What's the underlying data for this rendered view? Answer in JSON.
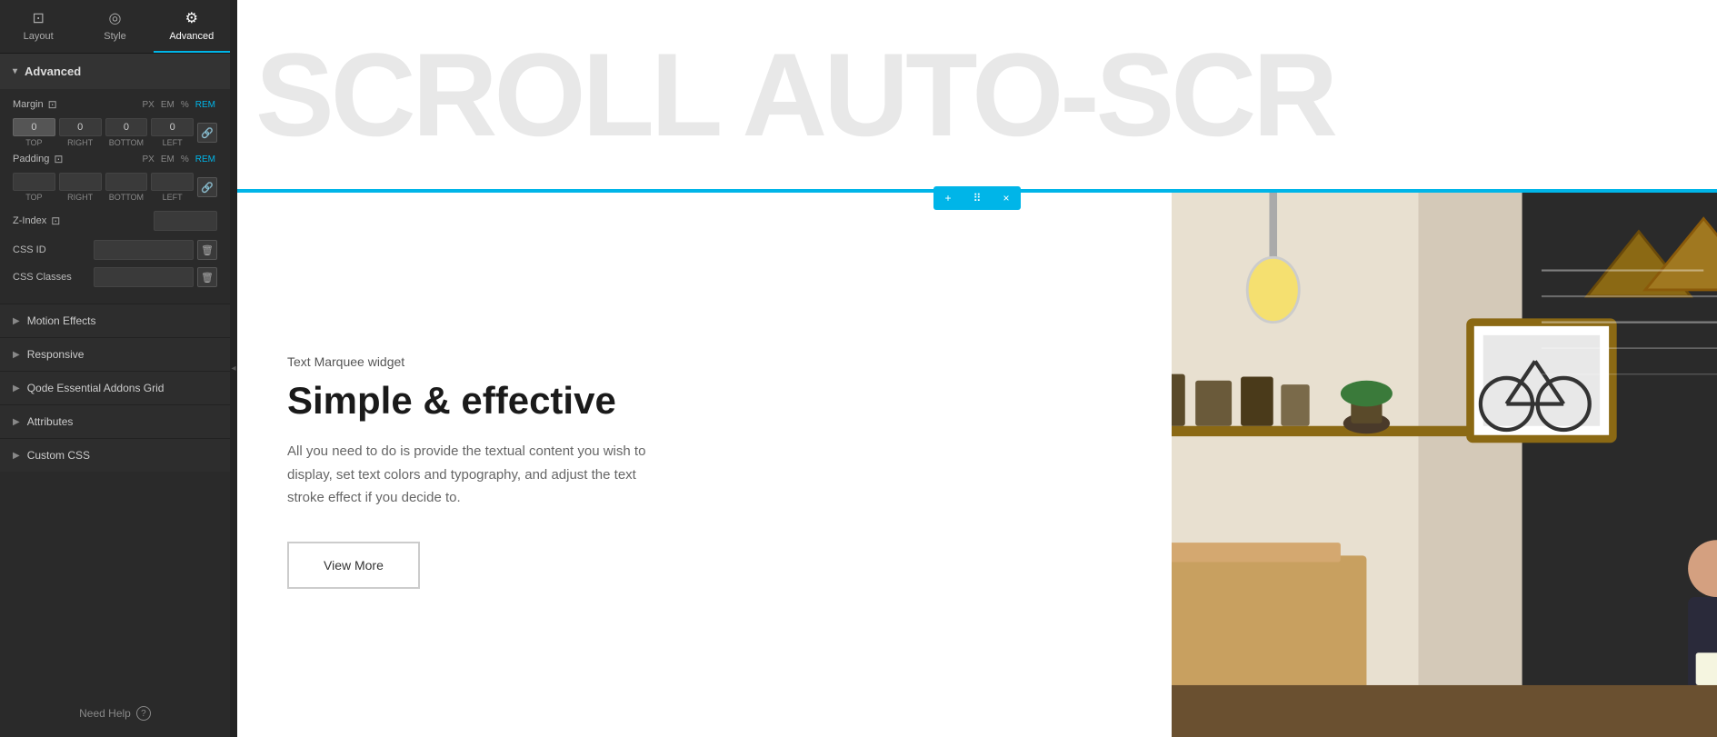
{
  "tabs": [
    {
      "id": "layout",
      "label": "Layout",
      "icon": "⊡",
      "active": false
    },
    {
      "id": "style",
      "label": "Style",
      "icon": "◎",
      "active": false
    },
    {
      "id": "advanced",
      "label": "Advanced",
      "icon": "⚙",
      "active": true
    }
  ],
  "panel": {
    "advanced_header": "Advanced",
    "margin_label": "Margin",
    "margin_units": [
      "PX",
      "EM",
      "%",
      "REM"
    ],
    "margin_active_unit": "REM",
    "margin_top": "0",
    "margin_right": "0",
    "margin_bottom": "0",
    "margin_left": "0",
    "margin_top_label": "TOP",
    "margin_right_label": "RIGHT",
    "margin_bottom_label": "BOTTOM",
    "margin_left_label": "LEFT",
    "padding_label": "Padding",
    "padding_units": [
      "PX",
      "EM",
      "%",
      "REM"
    ],
    "padding_active_unit": "REM",
    "padding_top": "",
    "padding_right": "",
    "padding_bottom": "",
    "padding_left": "",
    "padding_top_label": "TOP",
    "padding_right_label": "RIGHT",
    "padding_bottom_label": "BOTTOM",
    "padding_left_label": "LEFT",
    "zindex_label": "Z-Index",
    "zindex_value": "",
    "cssid_label": "CSS ID",
    "cssid_value": "",
    "cssclasses_label": "CSS Classes",
    "cssclasses_value": "",
    "motion_effects_label": "Motion Effects",
    "responsive_label": "Responsive",
    "qode_label": "Qode Essential Addons Grid",
    "attributes_label": "Attributes",
    "custom_css_label": "Custom CSS",
    "need_help_label": "Need Help"
  },
  "main": {
    "marquee_text": "SCROLL AUTO-SCR",
    "widget_label": "Text Marquee widget",
    "heading": "Simple & effective",
    "description": "All you need to do is provide the textual content you wish to display, set text colors and typography, and adjust the text stroke effect if you decide to.",
    "view_more_label": "View More",
    "plus_icon": "+",
    "move_icon": "⠿",
    "close_icon": "×"
  },
  "colors": {
    "accent": "#00b5e8",
    "panel_bg": "#2a2a2a",
    "panel_dark": "#222222",
    "text_light": "#cccccc",
    "border": "#444444"
  }
}
